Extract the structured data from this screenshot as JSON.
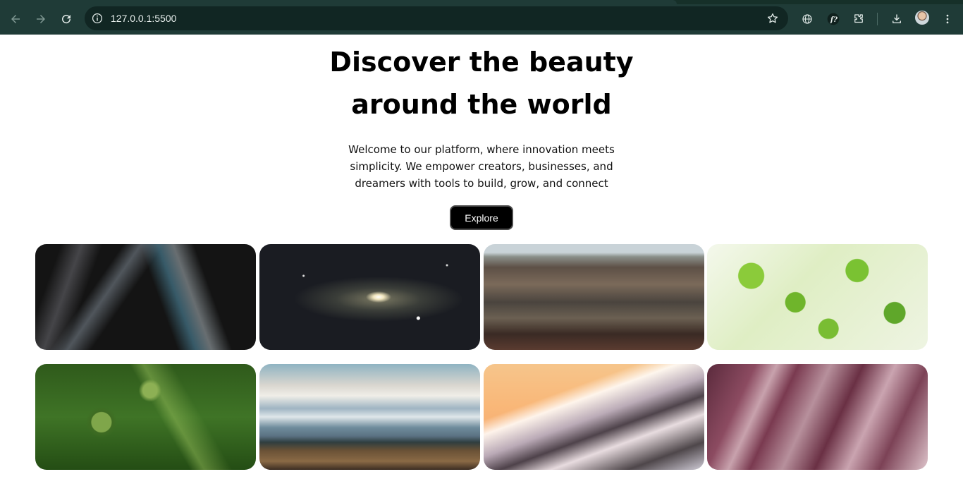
{
  "browser": {
    "url": "127.0.0.1:5500",
    "icons": {
      "back": "back-arrow-icon",
      "forward": "forward-arrow-icon",
      "reload": "reload-icon",
      "site_info": "info-icon",
      "bookmark": "star-icon",
      "extension_1": "globe-icon",
      "extension_2": "font-icon",
      "extensions": "puzzle-icon",
      "downloads": "download-icon",
      "profile": "avatar",
      "menu": "kebab-menu-icon"
    },
    "colors": {
      "chrome": "#1f3b37",
      "omnibox": "#112623"
    }
  },
  "hero": {
    "title_line1": "Discover the beauty",
    "title_line2": "around the world",
    "description": "Welcome to our platform, where innovation meets simplicity. We empower creators, businesses, and dreamers with tools to build, grow, and connect",
    "cta_label": "Explore"
  },
  "gallery": {
    "images": [
      "abstract-dark-ribbons",
      "galaxy-starfield",
      "volcanic-landscape",
      "green-leaves",
      "fern-fronds",
      "snowy-mountains-plain",
      "snowy-peak-sunset",
      "pink-folded-fabric"
    ]
  }
}
